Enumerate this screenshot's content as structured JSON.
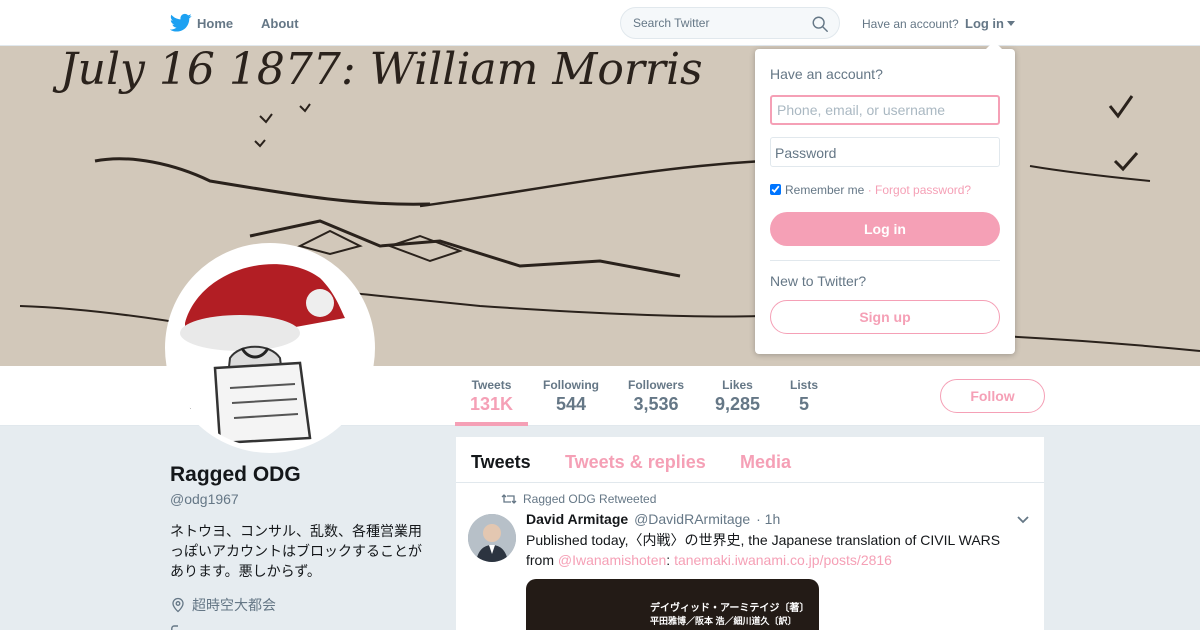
{
  "nav": {
    "logo_icon": "twitter-bird-icon",
    "home_label": "Home",
    "about_label": "About",
    "search_placeholder": "Search Twitter",
    "have_account": "Have an account?",
    "login_label": "Log in"
  },
  "profile": {
    "name": "Ragged ODG",
    "handle": "@odg1967",
    "bio": "ネトウヨ、コンサル、乱数、各種営業用っぽいアカウントはブロックすることがあります。悪しからず。",
    "location": "超時空大都会",
    "banner_text": "July 16 1877: William Morris"
  },
  "stats": [
    {
      "label": "Tweets",
      "value": "131K"
    },
    {
      "label": "Following",
      "value": "544"
    },
    {
      "label": "Followers",
      "value": "3,536"
    },
    {
      "label": "Likes",
      "value": "9,285"
    },
    {
      "label": "Lists",
      "value": "5"
    }
  ],
  "follow_label": "Follow",
  "timeline": {
    "tabs": [
      "Tweets",
      "Tweets & replies",
      "Media"
    ],
    "tweet": {
      "retweet_context": "Ragged ODG Retweeted",
      "author_name": "David Armitage",
      "author_handle": "@DavidRArmitage",
      "time": "· 1h",
      "text_part1": "Published today,〈内戦〉の世界史, the Japanese translation of CIVIL WARS from ",
      "mention": "@Iwanamishoten",
      "text_sep": ": ",
      "link": "tanemaki.iwanami.co.jp/posts/2816",
      "media_line1": "デイヴィッド・アーミテイジ〔著〕",
      "media_line2": "平田雅博／阪本 浩／細川道久〔訳〕"
    }
  },
  "login_dropdown": {
    "title": "Have an account?",
    "username_placeholder": "Phone, email, or username",
    "password_placeholder": "Password",
    "remember_label": "Remember me",
    "forgot_label": "· Forgot password?",
    "login_button": "Log in",
    "new_label": "New to Twitter?",
    "signup_button": "Sign up"
  },
  "colors": {
    "accent": "#f5a0b6",
    "text_secondary": "#657786",
    "background": "#e6ecf0"
  }
}
